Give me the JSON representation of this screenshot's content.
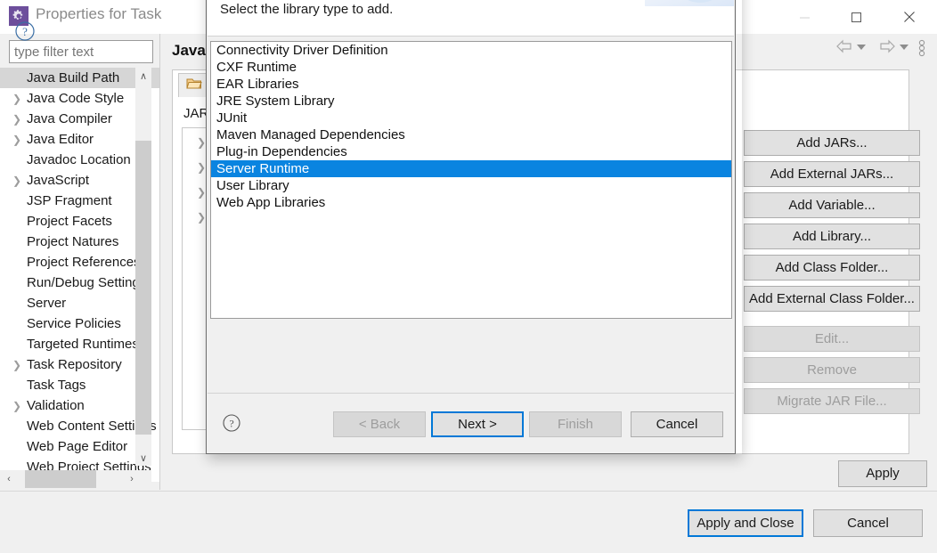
{
  "window": {
    "title": "Properties for Task",
    "icon": "gear-icon",
    "controls": {
      "minimize": "—",
      "maximize": "□",
      "close": "✕"
    },
    "nav": {
      "back": "back-arrow-icon",
      "back_dropdown": "chevron-down-icon",
      "forward": "forward-arrow-icon",
      "forward_dropdown": "chevron-down-icon",
      "menu": "view-menu-icon"
    }
  },
  "filter": {
    "placeholder": "type filter text",
    "value": ""
  },
  "sidebar": {
    "items": [
      {
        "label": "Java Build Path",
        "expandable": false,
        "selected": true
      },
      {
        "label": "Java Code Style",
        "expandable": true,
        "selected": false
      },
      {
        "label": "Java Compiler",
        "expandable": true,
        "selected": false
      },
      {
        "label": "Java Editor",
        "expandable": true,
        "selected": false
      },
      {
        "label": "Javadoc Location",
        "expandable": false,
        "selected": false
      },
      {
        "label": "JavaScript",
        "expandable": true,
        "selected": false
      },
      {
        "label": "JSP Fragment",
        "expandable": false,
        "selected": false
      },
      {
        "label": "Project Facets",
        "expandable": false,
        "selected": false
      },
      {
        "label": "Project Natures",
        "expandable": false,
        "selected": false
      },
      {
        "label": "Project References",
        "expandable": false,
        "selected": false
      },
      {
        "label": "Run/Debug Settings",
        "expandable": false,
        "selected": false
      },
      {
        "label": "Server",
        "expandable": false,
        "selected": false
      },
      {
        "label": "Service Policies",
        "expandable": false,
        "selected": false
      },
      {
        "label": "Targeted Runtimes",
        "expandable": false,
        "selected": false
      },
      {
        "label": "Task Repository",
        "expandable": true,
        "selected": false
      },
      {
        "label": "Task Tags",
        "expandable": false,
        "selected": false
      },
      {
        "label": "Validation",
        "expandable": true,
        "selected": false
      },
      {
        "label": "Web Content Settings",
        "expandable": false,
        "selected": false
      },
      {
        "label": "Web Page Editor",
        "expandable": false,
        "selected": false
      },
      {
        "label": "Web Project Settings",
        "expandable": false,
        "selected": false
      }
    ],
    "scroll_up": "∧",
    "scroll_down": "∨",
    "scroll_left": "‹",
    "scroll_right": "›"
  },
  "page": {
    "title": "Java Build Path",
    "tab_icon": "libraries-tab-icon",
    "list_label": "JARs and class folders on the build path:",
    "tree_rows": [
      "",
      "",
      "",
      ""
    ]
  },
  "side_buttons": [
    {
      "label": "Add JARs...",
      "enabled": true
    },
    {
      "label": "Add External JARs...",
      "enabled": true
    },
    {
      "label": "Add Variable...",
      "enabled": true
    },
    {
      "label": "Add Library...",
      "enabled": true
    },
    {
      "label": "Add Class Folder...",
      "enabled": true
    },
    {
      "label": "Add External Class Folder...",
      "enabled": true
    },
    {
      "label": "Edit...",
      "enabled": false
    },
    {
      "label": "Remove",
      "enabled": false
    },
    {
      "label": "Migrate JAR File...",
      "enabled": false
    }
  ],
  "apply_button": "Apply",
  "bottom": {
    "help_icon": "help-icon",
    "apply_and_close": "Apply and Close",
    "cancel": "Cancel"
  },
  "dialog": {
    "description": "Select the library type to add.",
    "banner_icon": "add-library-banner-icon",
    "options": [
      {
        "label": "Connectivity Driver Definition",
        "selected": false
      },
      {
        "label": "CXF Runtime",
        "selected": false
      },
      {
        "label": "EAR Libraries",
        "selected": false
      },
      {
        "label": "JRE System Library",
        "selected": false
      },
      {
        "label": "JUnit",
        "selected": false
      },
      {
        "label": "Maven Managed Dependencies",
        "selected": false
      },
      {
        "label": "Plug-in Dependencies",
        "selected": false
      },
      {
        "label": "Server Runtime",
        "selected": true
      },
      {
        "label": "User Library",
        "selected": false
      },
      {
        "label": "Web App Libraries",
        "selected": false
      }
    ],
    "help_icon": "help-icon",
    "buttons": {
      "back": {
        "label": "< Back",
        "enabled": false,
        "default": false
      },
      "next": {
        "label": "Next >",
        "enabled": true,
        "default": true
      },
      "finish": {
        "label": "Finish",
        "enabled": false,
        "default": false
      },
      "cancel": {
        "label": "Cancel",
        "enabled": true,
        "default": false
      }
    }
  },
  "colors": {
    "selection_blue": "#0a84e0",
    "focus_blue": "#0078d7",
    "window_bg": "#f0f0f0",
    "brand_purple": "#6d4f9c"
  }
}
